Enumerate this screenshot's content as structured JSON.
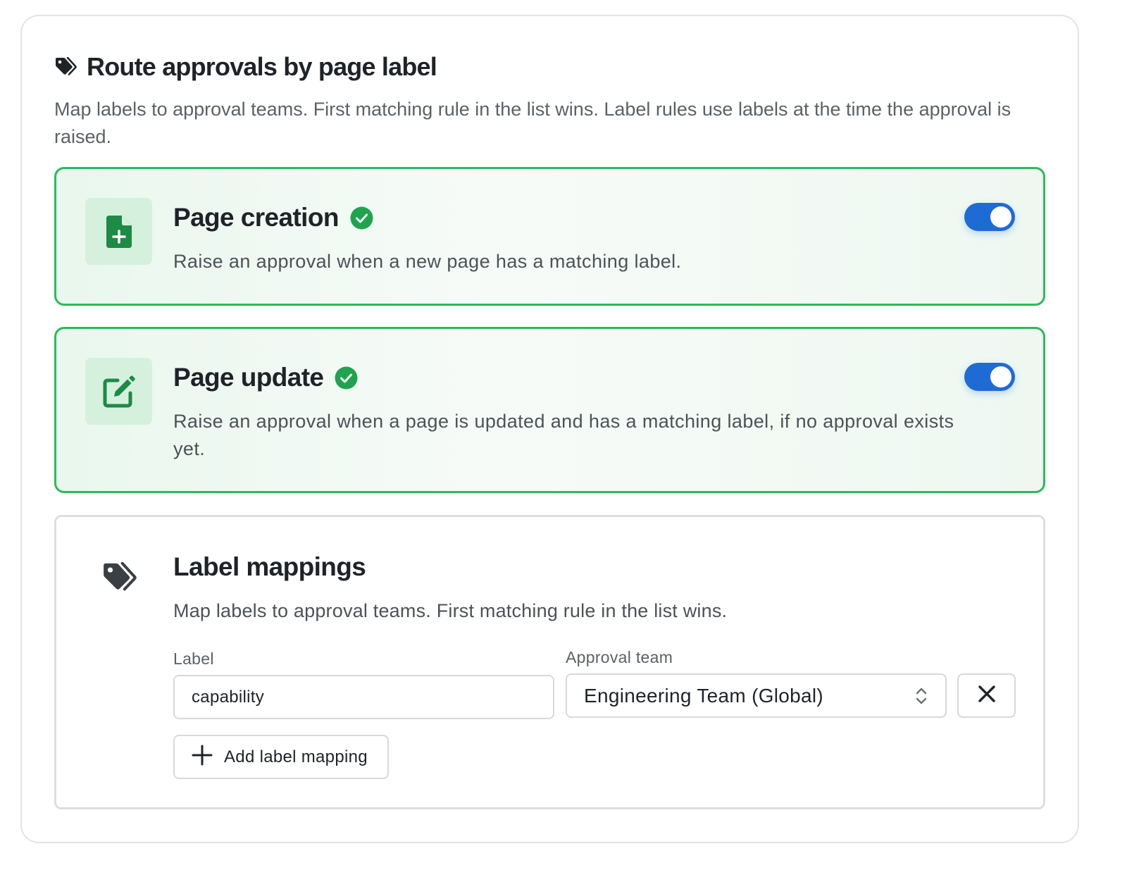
{
  "header": {
    "icon": "tags-icon",
    "title": "Route approvals by page label",
    "description": "Map labels to approval teams. First matching rule in the list wins. Label rules use labels at the time the approval is raised."
  },
  "options": [
    {
      "icon": "file-plus-icon",
      "title": "Page creation",
      "status_icon": "check-circle-icon",
      "description": "Raise an approval when a new page has a matching label.",
      "enabled": true
    },
    {
      "icon": "edit-icon",
      "title": "Page update",
      "status_icon": "check-circle-icon",
      "description": "Raise an approval when a page is updated and has a matching label, if no approval exists yet.",
      "enabled": true
    }
  ],
  "mappings": {
    "icon": "tags-icon",
    "title": "Label mappings",
    "description": "Map labels to approval teams. First matching rule in the list wins.",
    "label_field_label": "Label",
    "team_field_label": "Approval team",
    "rows": [
      {
        "label": "capability",
        "team": "Engineering Team (Global)"
      }
    ],
    "add_button_label": "Add label mapping"
  },
  "colors": {
    "accent_green": "#2bbb5a",
    "toggle_blue": "#1f6bd6",
    "icon_green": "#1d8a45"
  }
}
